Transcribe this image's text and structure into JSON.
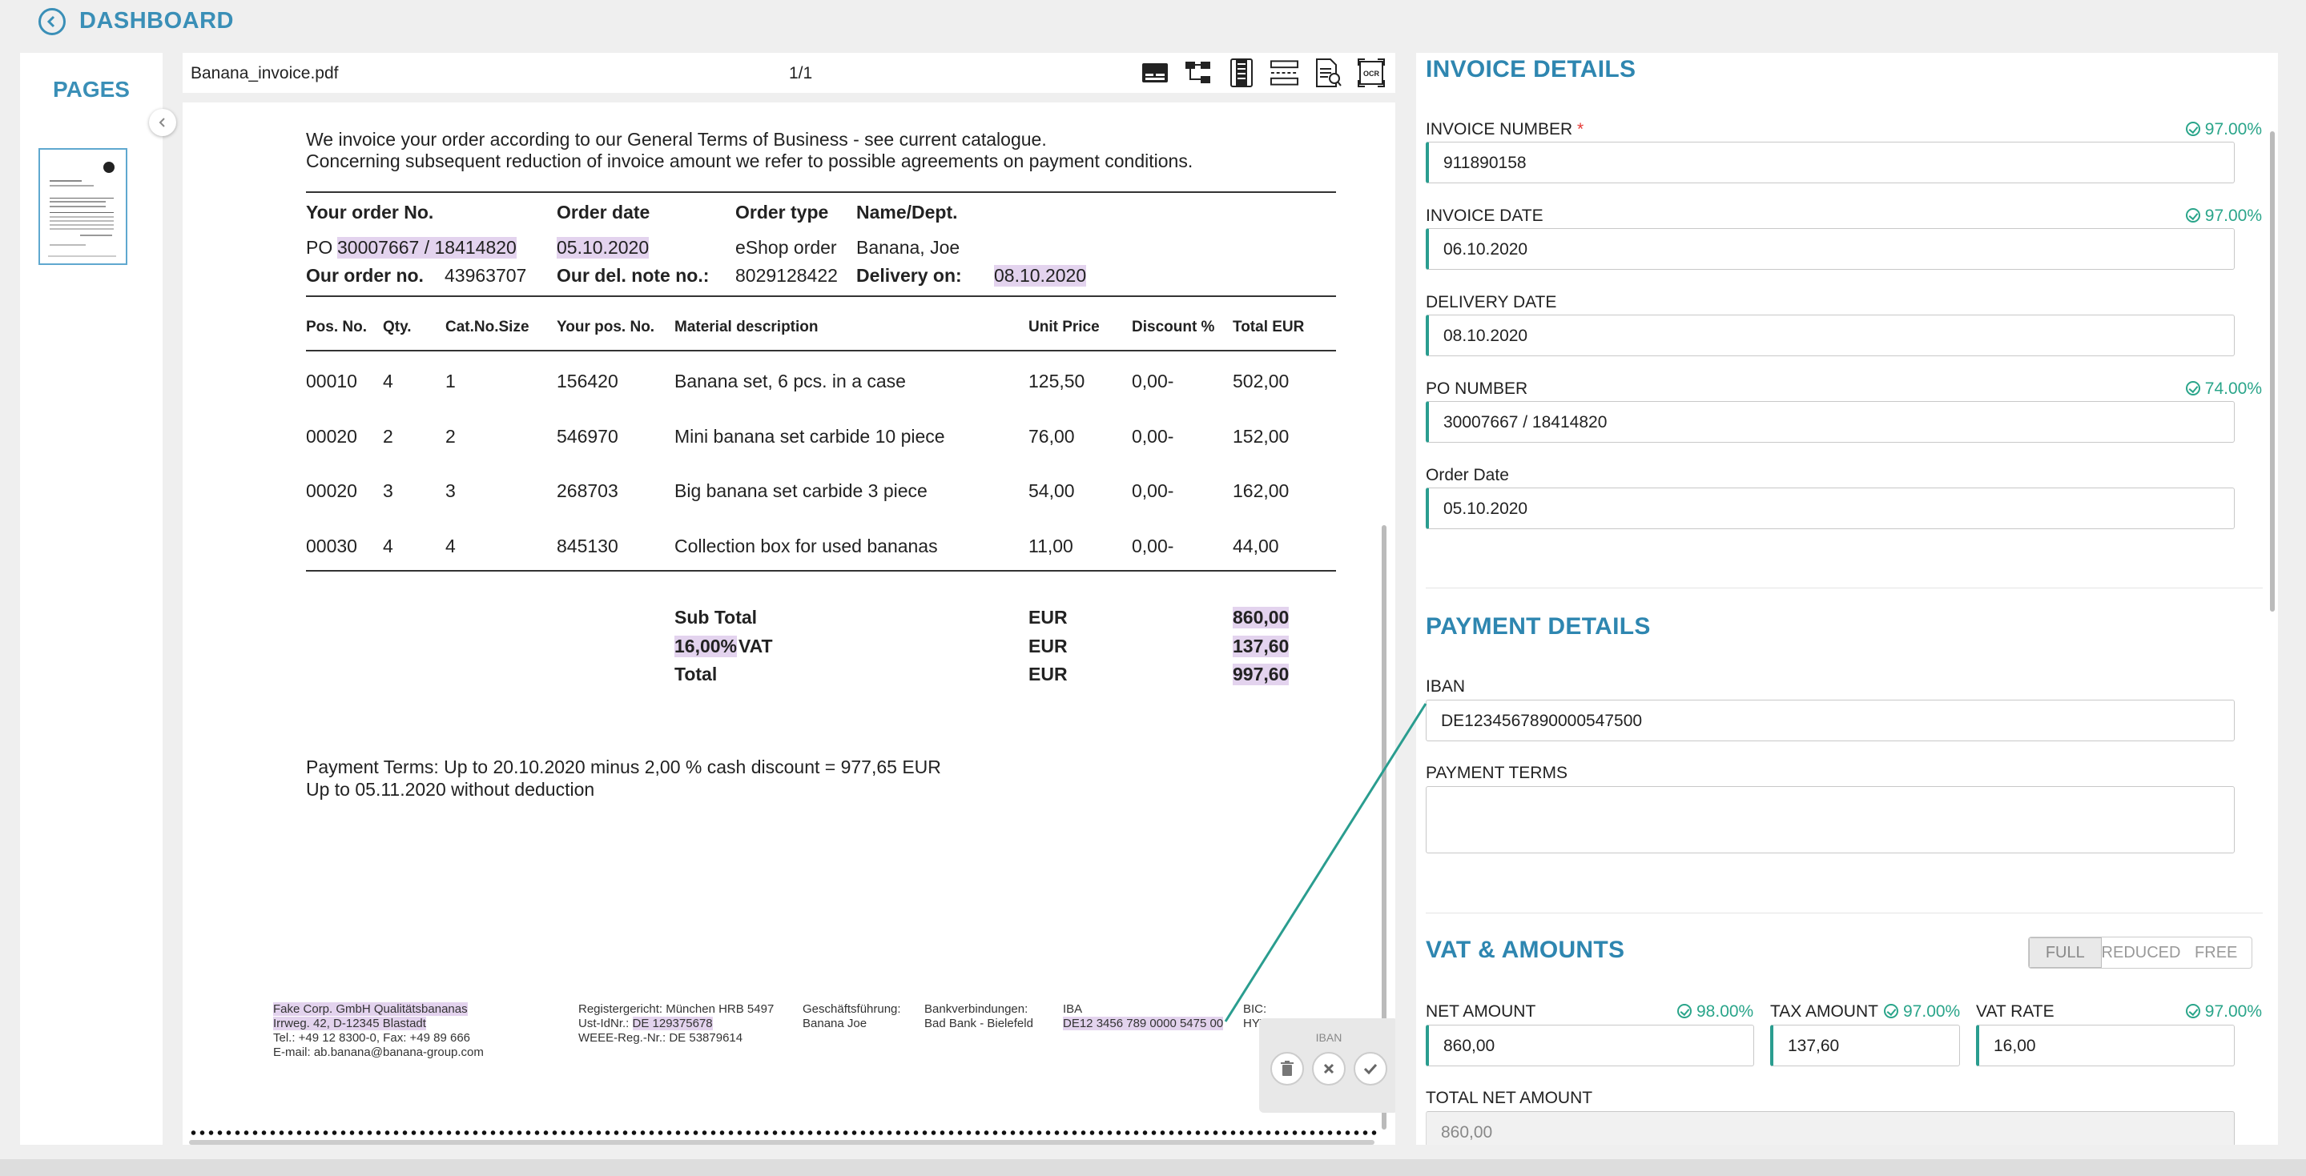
{
  "header": {
    "back_icon": "back-circle-icon",
    "title": "DASHBOARD"
  },
  "pages_panel": {
    "title": "PAGES"
  },
  "viewer": {
    "file_name": "Banana_invoice.pdf",
    "page_count": "1/1",
    "tools": [
      "table-icon",
      "tree-structure-icon",
      "column-icon",
      "row-split-icon",
      "text-extract-icon",
      "ocr-icon"
    ]
  },
  "document": {
    "intro1": "We invoice your order according to our General Terms of Business - see current catalogue.",
    "intro2": "Concerning subsequent reduction of invoice amount we refer to possible agreements on payment conditions.",
    "order_headers": {
      "your_order_no": "Your order No.",
      "order_date": "Order date",
      "order_type": "Order type",
      "name_dept": "Name/Dept."
    },
    "po_prefix": "PO",
    "po_value": "30007667 / 18414820",
    "order_date_value": "05.10.2020",
    "order_type_value": "eShop order",
    "name_value": "Banana, Joe",
    "our_order_label": "Our order no.",
    "our_order_value": "43963707",
    "del_note_label": "Our del. note no.:",
    "del_note_value": "8029128422",
    "delivery_on_label": "Delivery on:",
    "delivery_on_value": "08.10.2020",
    "columns": [
      "Pos. No.",
      "Qty.",
      "Cat.No.Size",
      "Your pos. No.",
      "Material description",
      "Unit Price",
      "Discount %",
      "Total EUR"
    ],
    "rows": [
      [
        "00010",
        "4",
        "1",
        "156420",
        "Banana set, 6 pcs. in a case",
        "125,50",
        "0,00-",
        "502,00"
      ],
      [
        "00020",
        "2",
        "2",
        "546970",
        "Mini banana set carbide 10 piece",
        "76,00",
        "0,00-",
        "152,00"
      ],
      [
        "00020",
        "3",
        "3",
        "268703",
        "Big banana set carbide 3 piece",
        "54,00",
        "0,00-",
        "162,00"
      ],
      [
        "00030",
        "4",
        "4",
        "845130",
        "Collection box for used bananas",
        "11,00",
        "0,00-",
        "44,00"
      ]
    ],
    "subtotal_label": "Sub Total",
    "vat_pct": "16,00%",
    "vat_label": "VAT",
    "total_label": "Total",
    "currency": "EUR",
    "subtotal_value": "860,00",
    "vat_value": "137,60",
    "total_value": "997,60",
    "terms1": "Payment Terms: Up to 20.10.2020 minus 2,00 % cash discount = 977,65 EUR",
    "terms2": "Up to 05.11.2020 without deduction",
    "footer": {
      "c1l1": "Fake Corp. GmbH Qualitätsbananas",
      "c1l2": "Irrweg. 42, D-12345 Blastadt",
      "c1l3": "Tel.: +49 12 8300-0, Fax: +49 89 666",
      "c1l4": "E-mail: ab.banana@banana-group.com",
      "c2l1": "Registergericht: München HRB 5497",
      "c2l2a": "Ust-IdNr.:",
      "c2l2b": "DE 129375678",
      "c2l3": "WEEE-Reg.-Nr.: DE 53879614",
      "c3l1": "Geschäftsführung:",
      "c3l2": "Banana Joe",
      "c4l1": "Bankverbindungen:",
      "c4l2": "Bad Bank - Bielefeld",
      "c5l1": "IBA",
      "c5l2": "DE12 3456 789 0000 5475 00",
      "c6l1": "BIC:",
      "c6l2": "HYVEDAMM"
    },
    "popup": {
      "label": "IBAN",
      "delete_icon": "trash-icon",
      "cancel_icon": "close-icon",
      "confirm_icon": "check-icon"
    }
  },
  "invoice_details": {
    "title": "INVOICE DETAILS",
    "invoice_number": {
      "label": "INVOICE NUMBER",
      "required": "*",
      "confidence": "97.00%",
      "value": "911890158"
    },
    "invoice_date": {
      "label": "INVOICE DATE",
      "confidence": "97.00%",
      "value": "06.10.2020"
    },
    "delivery_date": {
      "label": "DELIVERY DATE",
      "value": "08.10.2020"
    },
    "po_number": {
      "label": "PO NUMBER",
      "confidence": "74.00%",
      "value": "30007667 / 18414820"
    },
    "order_date": {
      "label": "Order Date",
      "value": "05.10.2020"
    }
  },
  "payment_details": {
    "title": "PAYMENT DETAILS",
    "iban": {
      "label": "IBAN",
      "value": "DE1234567890000547500"
    },
    "payment_terms": {
      "label": "PAYMENT TERMS",
      "value": ""
    }
  },
  "vat_amounts": {
    "title": "VAT & AMOUNTS",
    "modes": [
      "FULL",
      "REDUCED",
      "FREE"
    ],
    "selected_mode": "FULL",
    "net_amount": {
      "label": "NET AMOUNT",
      "confidence": "98.00%",
      "value": "860,00"
    },
    "tax_amount": {
      "label": "TAX AMOUNT",
      "confidence": "97.00%",
      "value": "137,60"
    },
    "vat_rate": {
      "label": "VAT RATE",
      "confidence": "97.00%",
      "value": "16,00"
    },
    "total_net_amount": {
      "label": "TOTAL NET AMOUNT",
      "value": "860,00"
    }
  },
  "colors": {
    "accent": "#2e86b0",
    "confidence": "#2aa58a",
    "highlight": "#e3d3ee",
    "field_border": "#2a9d8f"
  }
}
